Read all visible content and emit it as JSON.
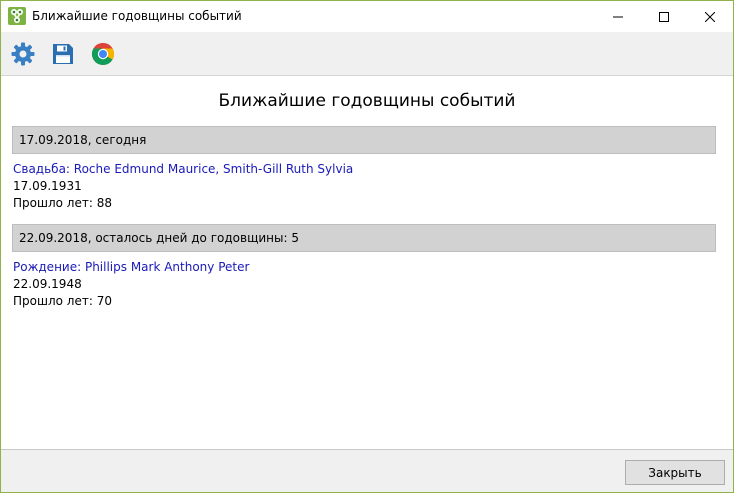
{
  "window": {
    "title": "Ближайшие годовщины событий"
  },
  "toolbar": {
    "icons": [
      "gear-icon",
      "save-icon",
      "chrome-icon"
    ]
  },
  "report": {
    "title": "Ближайшие годовщины событий",
    "groups": [
      {
        "header": "17.09.2018, сегодня",
        "event": {
          "link": "Свадьба: Roche Edmund Maurice, Smith-Gill Ruth Sylvia",
          "date": "17.09.1931",
          "years": "Прошло лет: 88"
        }
      },
      {
        "header": "22.09.2018, осталось дней до годовщины: 5",
        "event": {
          "link": "Рождение: Phillips Mark Anthony Peter",
          "date": "22.09.1948",
          "years": "Прошло лет: 70"
        }
      }
    ]
  },
  "footer": {
    "close_label": "Закрыть"
  },
  "colors": {
    "window_border": "#8fb34a",
    "link": "#1a1ab8",
    "header_bg": "#d2d2d2",
    "gear": "#3a7fc4",
    "save": "#2a6fb0"
  }
}
